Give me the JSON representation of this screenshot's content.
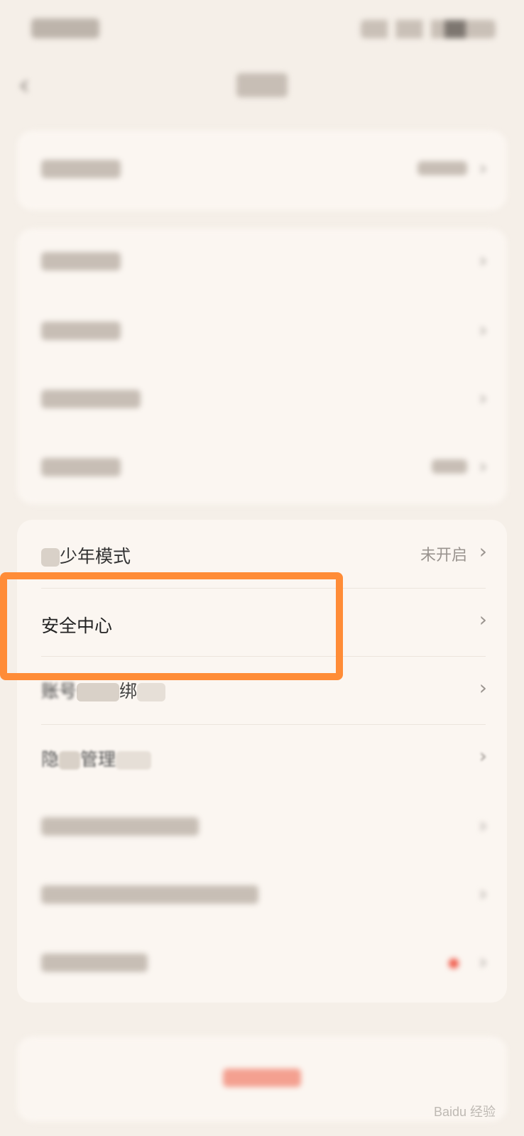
{
  "nav": {
    "back_icon": "chevron-left-icon"
  },
  "sections": {
    "section3": {
      "items": [
        {
          "label_partial": "少年模式",
          "value": "未开启"
        },
        {
          "label": "安全中心"
        },
        {
          "label_partial": "账号",
          "label_partial2": "绑"
        },
        {
          "label_partial": "隐",
          "label_partial2": "管理"
        }
      ]
    }
  },
  "watermark": "Baidu 经验",
  "chevron": "›"
}
